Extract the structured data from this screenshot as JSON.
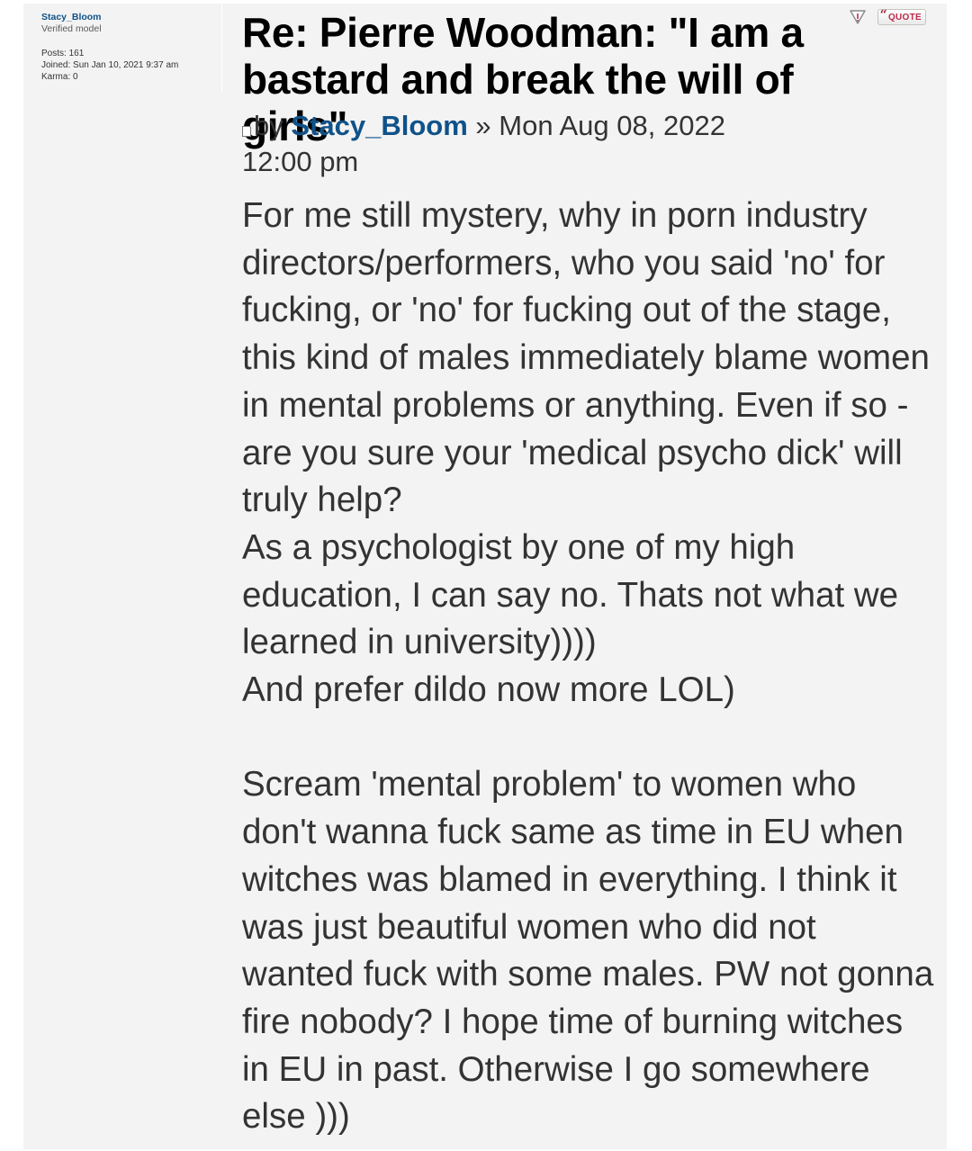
{
  "profile": {
    "username": "Stacy_Bloom",
    "rank": "Verified model",
    "posts_label": "Posts:",
    "posts_value": "161",
    "joined_label": "Joined:",
    "joined_value": "Sun Jan 10, 2021 9:37 am",
    "karma_label": "Karma:",
    "karma_value": "0"
  },
  "post": {
    "title": "Re: Pierre Woodman: \"I am a bastard and break the will of girls\"",
    "by_label": "by",
    "author": "Stacy_Bloom",
    "separator": "»",
    "date": "Mon Aug 08, 2022 12:00 pm",
    "body_paragraphs": [
      "For me still mystery, why in porn industry directors/performers, who you said 'no' for fucking, or 'no' for fucking out of the stage, this kind of males immediately blame women in mental problems or anything. Even if so - are you sure your 'medical psycho dick' will truly help?",
      "As a psychologist by one of my high education, I can say no. Thats not what we learned in university))))",
      "And prefer dildo now more LOL)",
      "",
      "Scream 'mental problem' to women who don't wanna fuck same as time in EU when witches was blamed in everything. I think it was just beautiful women who did not wanted fuck with some males. PW not gonna fire nobody? I hope time of burning witches in EU in past. Otherwise I go somewhere else )))"
    ]
  },
  "buttons": {
    "report_icon": "report-warning-icon",
    "quote_label": "QUOTE",
    "quote_icon": "quote-marks-icon"
  },
  "colors": {
    "post_background": "#f3f3f3",
    "author_link": "#105289",
    "quote_text": "#bc2a4d"
  }
}
